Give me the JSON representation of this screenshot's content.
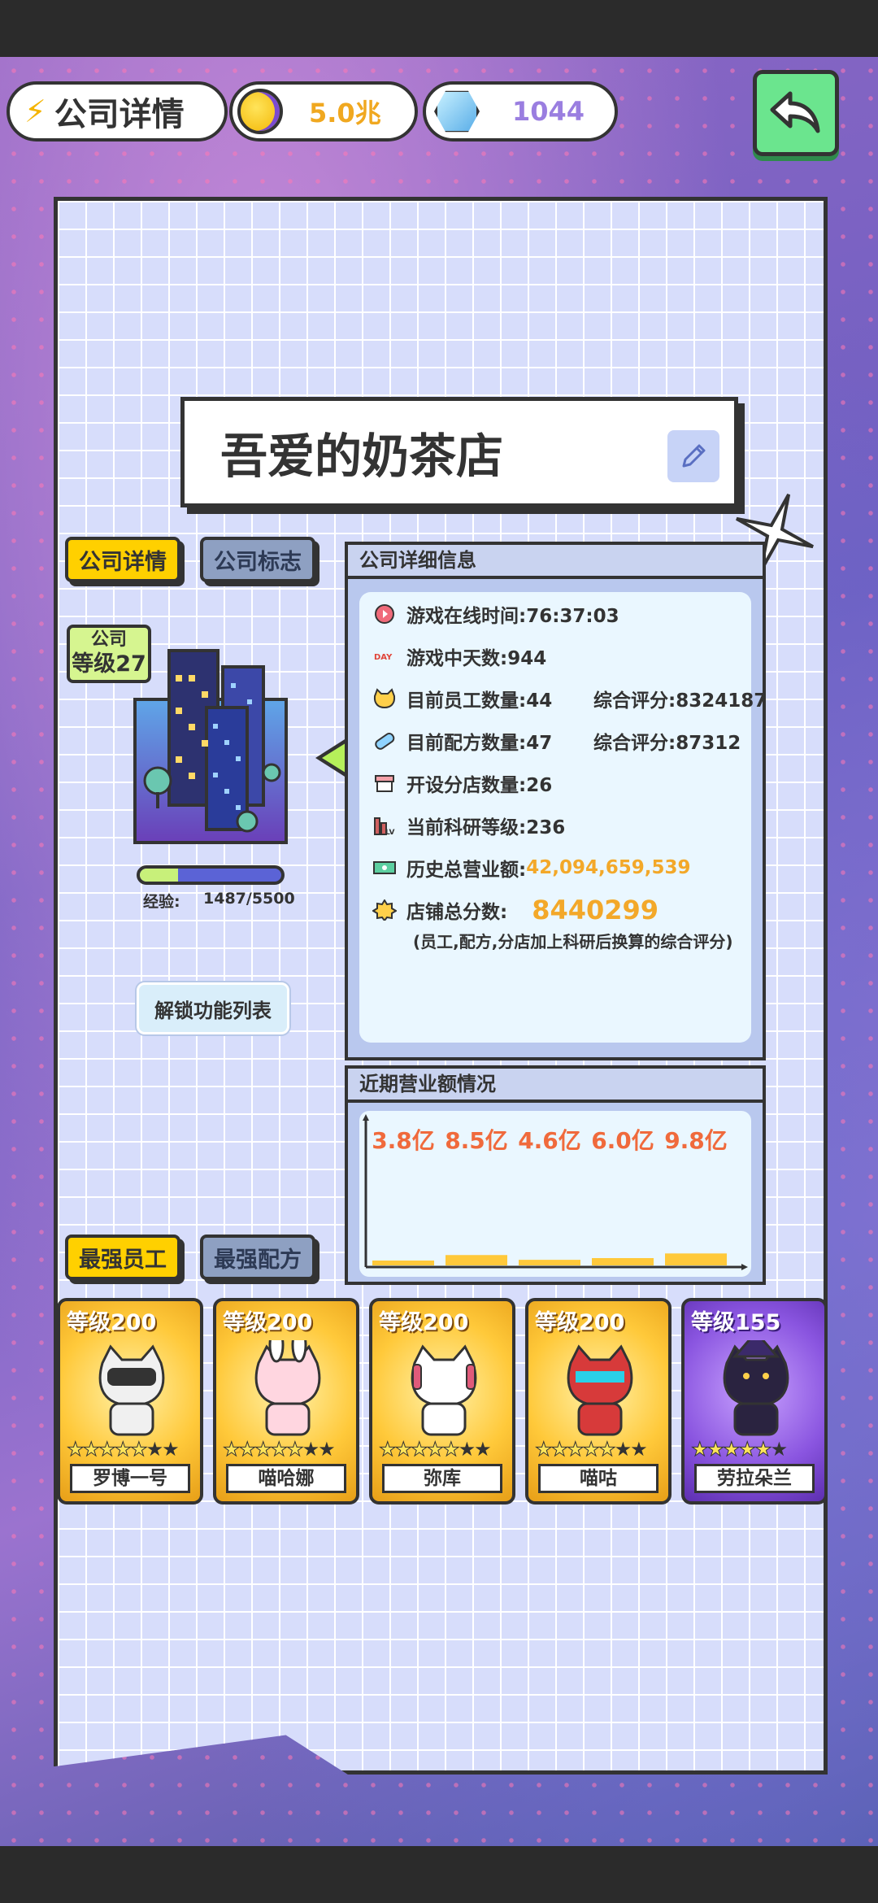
{
  "header": {
    "title": "公司详情",
    "coins": "5.0兆",
    "gems": "1044"
  },
  "company": {
    "name": "吾爱的奶茶店",
    "tabs": [
      "公司详情",
      "公司标志"
    ],
    "level_label": "公司",
    "level_value": "等级27",
    "exp_label": "经验:",
    "exp_value": "1487/5500",
    "exp_progress": 0.27,
    "unlock_label": "解锁功能列表"
  },
  "info": {
    "title": "公司详细信息",
    "rows": [
      {
        "icon": "clock-icon",
        "text": "游戏在线时间:76:37:03"
      },
      {
        "icon": "day-icon",
        "text": "游戏中天数:944"
      },
      {
        "icon": "cat-face-icon",
        "text": "目前员工数量:44",
        "extra": "综合评分:8324187"
      },
      {
        "icon": "recipe-capsule-icon",
        "text": "目前配方数量:47",
        "extra": "综合评分:87312"
      },
      {
        "icon": "shop-icon",
        "text": "开设分店数量:26"
      },
      {
        "icon": "research-lv-icon",
        "text": "当前科研等级:236"
      },
      {
        "icon": "cash-icon",
        "text": "历史总营业额:",
        "value": "42,094,659,539"
      },
      {
        "icon": "badge-icon",
        "text": "店铺总分数:",
        "value": "8440299"
      }
    ],
    "note": "(员工,配方,分店加上科研后换算的综合评分)"
  },
  "revenue": {
    "title": "近期营业额情况"
  },
  "chart_data": {
    "type": "bar",
    "categories": [
      "",
      "",
      "",
      "",
      ""
    ],
    "values": [
      3.8,
      8.5,
      4.6,
      6.0,
      9.8
    ],
    "labels": [
      "3.8亿",
      "8.5亿",
      "4.6亿",
      "6.0亿",
      "9.8亿"
    ],
    "label_color": "#f06a3c",
    "bar_color": "#ffc93a",
    "title": "近期营业额情况",
    "xlabel": "",
    "ylabel": ""
  },
  "ranking": {
    "tabs": [
      "最强员工",
      "最强配方"
    ],
    "cards": [
      {
        "level": "等级200",
        "name": "罗博一号",
        "stars": 5,
        "max_stars": 7,
        "style": "gold",
        "cat": "robot"
      },
      {
        "level": "等级200",
        "name": "喵哈娜",
        "stars": 5,
        "max_stars": 7,
        "style": "gold",
        "cat": "bunny"
      },
      {
        "level": "等级200",
        "name": "弥库",
        "stars": 5,
        "max_stars": 7,
        "style": "gold",
        "cat": "miku"
      },
      {
        "level": "等级200",
        "name": "喵咕",
        "stars": 5,
        "max_stars": 7,
        "style": "gold",
        "cat": "mech"
      },
      {
        "level": "等级155",
        "name": "劳拉朵兰",
        "stars": 5,
        "max_stars": 6,
        "style": "purple",
        "cat": "witch"
      }
    ]
  }
}
